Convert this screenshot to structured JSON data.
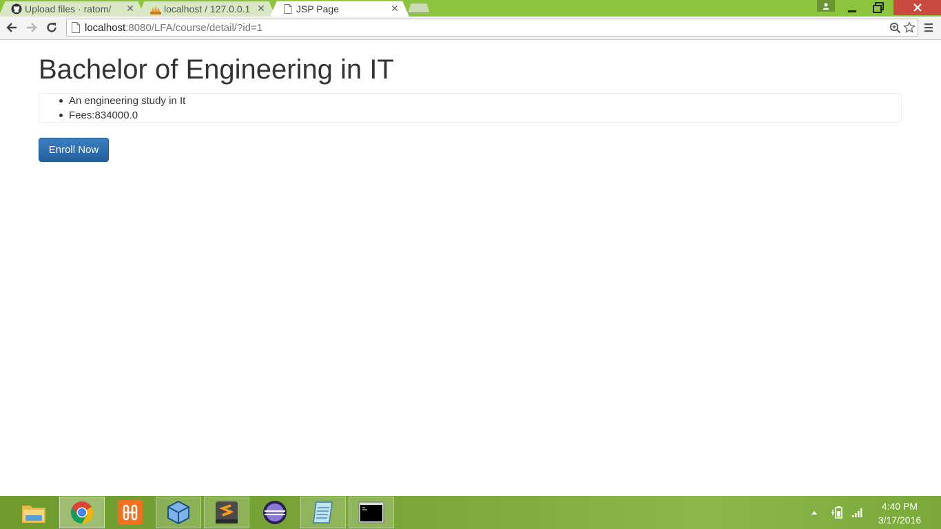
{
  "browser": {
    "tabs": [
      {
        "title": "Upload files · ratom/",
        "icon": "github-icon"
      },
      {
        "title": "localhost / 127.0.0.1",
        "icon": "phpmyadmin-icon"
      },
      {
        "title": "JSP Page",
        "icon": "page-icon",
        "active": true
      }
    ],
    "close_glyph": "✕",
    "address": {
      "host": "localhost",
      "rest": ":8080/LFA/course/detail/?id=1"
    }
  },
  "page": {
    "title": "Bachelor of Engineering in IT",
    "details": [
      "An engineering study in It",
      "Fees:834000.0"
    ],
    "enroll_label": "Enroll Now"
  },
  "taskbar": {
    "apps": [
      {
        "name": "file-explorer-icon",
        "open": false
      },
      {
        "name": "chrome-icon",
        "open": true,
        "active": true
      },
      {
        "name": "xampp-icon",
        "open": false
      },
      {
        "name": "virtualbox-icon",
        "open": true
      },
      {
        "name": "sublime-text-icon",
        "open": true
      },
      {
        "name": "eclipse-icon",
        "open": false
      },
      {
        "name": "notepad-icon",
        "open": true
      },
      {
        "name": "command-prompt-icon",
        "open": true
      }
    ],
    "clock": {
      "time": "4:40 PM",
      "date": "3/17/2016"
    }
  },
  "colors": {
    "chrome_frame": "#8cc43c",
    "close_button": "#c94b3f",
    "enroll_button": "#2d6ca8",
    "taskbar": "#7aa83a"
  }
}
